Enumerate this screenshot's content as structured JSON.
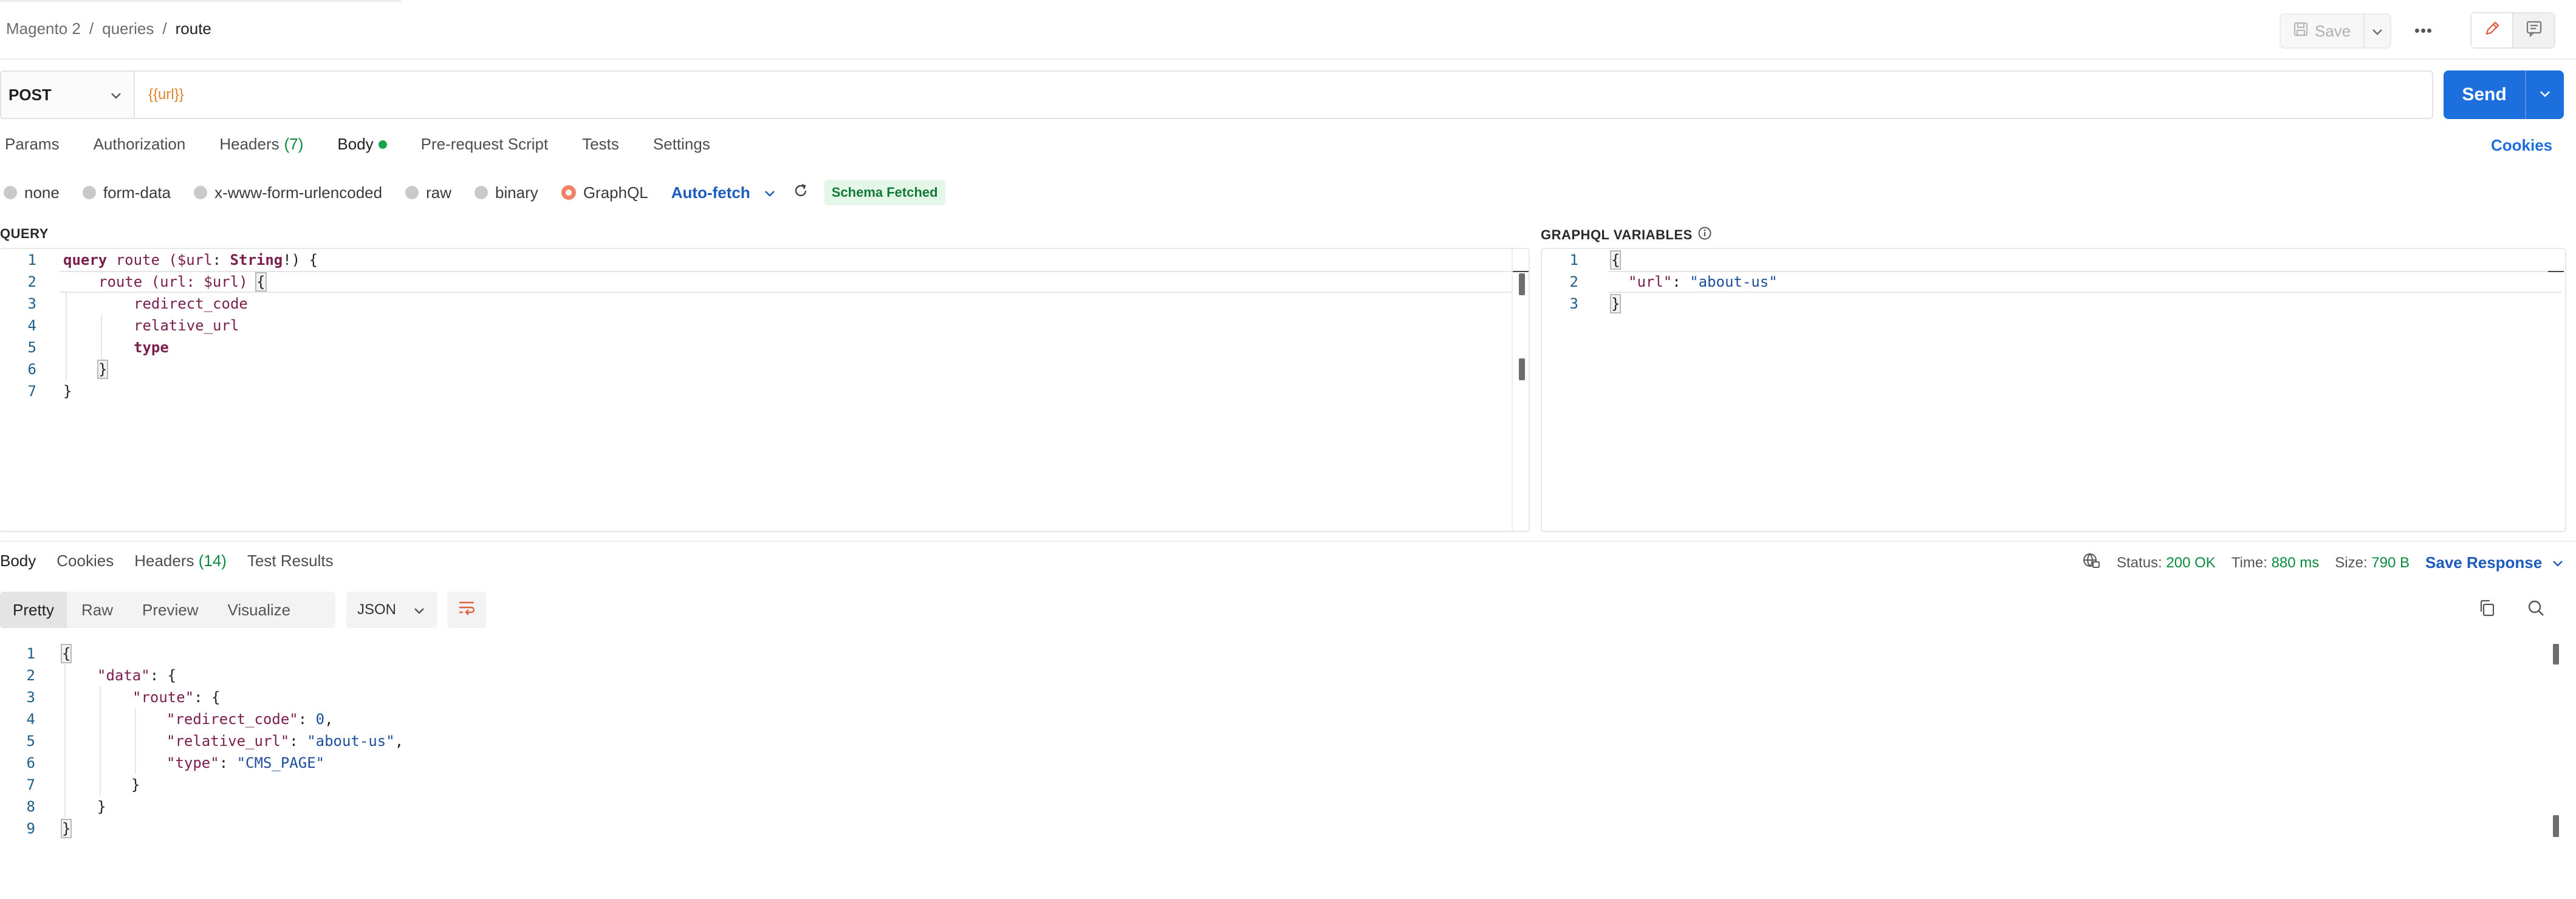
{
  "breadcrumb": {
    "collection": "Magento 2",
    "folder": "queries",
    "request": "route",
    "separator": "/"
  },
  "toolbar": {
    "save_label": "Save",
    "more_label": "•••"
  },
  "request": {
    "method": "POST",
    "url": "{{url}}",
    "send_label": "Send"
  },
  "request_tabs": [
    {
      "label": "Params"
    },
    {
      "label": "Authorization"
    },
    {
      "label": "Headers",
      "count": "(7)"
    },
    {
      "label": "Body"
    },
    {
      "label": "Pre-request Script"
    },
    {
      "label": "Tests"
    },
    {
      "label": "Settings"
    }
  ],
  "cookies_label": "Cookies",
  "body_modes": [
    {
      "label": "none"
    },
    {
      "label": "form-data"
    },
    {
      "label": "x-www-form-urlencoded"
    },
    {
      "label": "raw"
    },
    {
      "label": "binary"
    },
    {
      "label": "GraphQL",
      "selected": true
    }
  ],
  "autofetch_label": "Auto-fetch",
  "schema_badge": "Schema Fetched",
  "query_label": "QUERY",
  "variables_label": "GRAPHQL VARIABLES",
  "query_lines": [
    "1",
    "2",
    "3",
    "4",
    "5",
    "6",
    "7"
  ],
  "query_code": {
    "l1_kw": "query",
    "l1_name": " route (",
    "l1_var": "$url",
    "l1_colon": ": ",
    "l1_type": "String",
    "l1_end": "!) {",
    "l2_field": "route",
    "l2_args": " (url: $url) ",
    "l2_brace": "{",
    "l3": "redirect_code",
    "l4": "relative_url",
    "l5": "type",
    "l6": "}",
    "l7": "}"
  },
  "variables_lines": [
    "1",
    "2",
    "3"
  ],
  "variables_code": {
    "l1": "{",
    "l2_key": "\"url\"",
    "l2_colon": ": ",
    "l2_val": "\"about-us\"",
    "l3": "}"
  },
  "response_tabs": [
    {
      "label": "Body"
    },
    {
      "label": "Cookies"
    },
    {
      "label": "Headers",
      "count": "(14)"
    },
    {
      "label": "Test Results"
    }
  ],
  "status": {
    "status_label": "Status:",
    "status_value": "200 OK",
    "time_label": "Time:",
    "time_value": "880 ms",
    "size_label": "Size:",
    "size_value": "790 B",
    "save_response": "Save Response"
  },
  "view_modes": [
    {
      "label": "Pretty"
    },
    {
      "label": "Raw"
    },
    {
      "label": "Preview"
    },
    {
      "label": "Visualize"
    }
  ],
  "format": "JSON",
  "response_lines": [
    "1",
    "2",
    "3",
    "4",
    "5",
    "6",
    "7",
    "8",
    "9"
  ],
  "response_code": {
    "l1": "{",
    "l2_key": "\"data\"",
    "l2_rest": ": {",
    "l3_key": "\"route\"",
    "l3_rest": ": {",
    "l4_key": "\"redirect_code\"",
    "l4_sep": ": ",
    "l4_val": "0",
    "l4_end": ",",
    "l5_key": "\"relative_url\"",
    "l5_sep": ": ",
    "l5_val": "\"about-us\"",
    "l5_end": ",",
    "l6_key": "\"type\"",
    "l6_sep": ": ",
    "l6_val": "\"CMS_PAGE\"",
    "l7": "}",
    "l8": "}",
    "l9": "}"
  },
  "colors": {
    "accent": "#1c6fdc",
    "graphql_radio": "#ee8166",
    "status_ok": "#0a8a3e"
  }
}
